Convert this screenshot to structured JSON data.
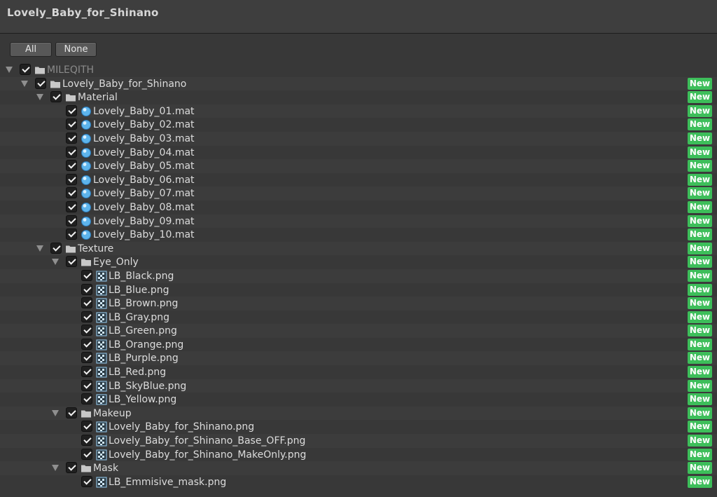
{
  "window": {
    "title": "Lovely_Baby_for_Shinano"
  },
  "toolbar": {
    "all_label": "All",
    "none_label": "None"
  },
  "badge_label": "New",
  "colors": {
    "badge": "#3dbe5a",
    "background": "#383838",
    "checkbox": "#202020"
  },
  "tree": [
    {
      "label": "MILEQITH",
      "depth": 0,
      "type": "folder",
      "expandable": true,
      "dim": true,
      "badge": false
    },
    {
      "label": "Lovely_Baby_for_Shinano",
      "depth": 1,
      "type": "folder",
      "expandable": true,
      "badge": true
    },
    {
      "label": "Material",
      "depth": 2,
      "type": "folder",
      "expandable": true,
      "badge": true
    },
    {
      "label": "Lovely_Baby_01.mat",
      "depth": 3,
      "type": "material",
      "badge": true
    },
    {
      "label": "Lovely_Baby_02.mat",
      "depth": 3,
      "type": "material",
      "badge": true
    },
    {
      "label": "Lovely_Baby_03.mat",
      "depth": 3,
      "type": "material",
      "badge": true
    },
    {
      "label": "Lovely_Baby_04.mat",
      "depth": 3,
      "type": "material",
      "badge": true
    },
    {
      "label": "Lovely_Baby_05.mat",
      "depth": 3,
      "type": "material",
      "badge": true
    },
    {
      "label": "Lovely_Baby_06.mat",
      "depth": 3,
      "type": "material",
      "badge": true
    },
    {
      "label": "Lovely_Baby_07.mat",
      "depth": 3,
      "type": "material",
      "badge": true
    },
    {
      "label": "Lovely_Baby_08.mat",
      "depth": 3,
      "type": "material",
      "badge": true
    },
    {
      "label": "Lovely_Baby_09.mat",
      "depth": 3,
      "type": "material",
      "badge": true
    },
    {
      "label": "Lovely_Baby_10.mat",
      "depth": 3,
      "type": "material",
      "badge": true
    },
    {
      "label": "Texture",
      "depth": 2,
      "type": "folder",
      "expandable": true,
      "badge": true
    },
    {
      "label": "Eye_Only",
      "depth": 3,
      "type": "folder",
      "expandable": true,
      "badge": true
    },
    {
      "label": "LB_Black.png",
      "depth": 4,
      "type": "texture",
      "badge": true
    },
    {
      "label": "LB_Blue.png",
      "depth": 4,
      "type": "texture",
      "badge": true
    },
    {
      "label": "LB_Brown.png",
      "depth": 4,
      "type": "texture",
      "badge": true
    },
    {
      "label": "LB_Gray.png",
      "depth": 4,
      "type": "texture",
      "badge": true
    },
    {
      "label": "LB_Green.png",
      "depth": 4,
      "type": "texture",
      "badge": true
    },
    {
      "label": "LB_Orange.png",
      "depth": 4,
      "type": "texture",
      "badge": true
    },
    {
      "label": "LB_Purple.png",
      "depth": 4,
      "type": "texture",
      "badge": true
    },
    {
      "label": "LB_Red.png",
      "depth": 4,
      "type": "texture",
      "badge": true
    },
    {
      "label": "LB_SkyBlue.png",
      "depth": 4,
      "type": "texture",
      "badge": true
    },
    {
      "label": "LB_Yellow.png",
      "depth": 4,
      "type": "texture",
      "badge": true
    },
    {
      "label": "Makeup",
      "depth": 3,
      "type": "folder",
      "expandable": true,
      "badge": true
    },
    {
      "label": "Lovely_Baby_for_Shinano.png",
      "depth": 4,
      "type": "texture",
      "badge": true
    },
    {
      "label": "Lovely_Baby_for_Shinano_Base_OFF.png",
      "depth": 4,
      "type": "texture",
      "badge": true
    },
    {
      "label": "Lovely_Baby_for_Shinano_MakeOnly.png",
      "depth": 4,
      "type": "texture",
      "badge": true
    },
    {
      "label": "Mask",
      "depth": 3,
      "type": "folder",
      "expandable": true,
      "badge": true
    },
    {
      "label": "LB_Emmisive_mask.png",
      "depth": 4,
      "type": "texture",
      "badge": true
    }
  ]
}
